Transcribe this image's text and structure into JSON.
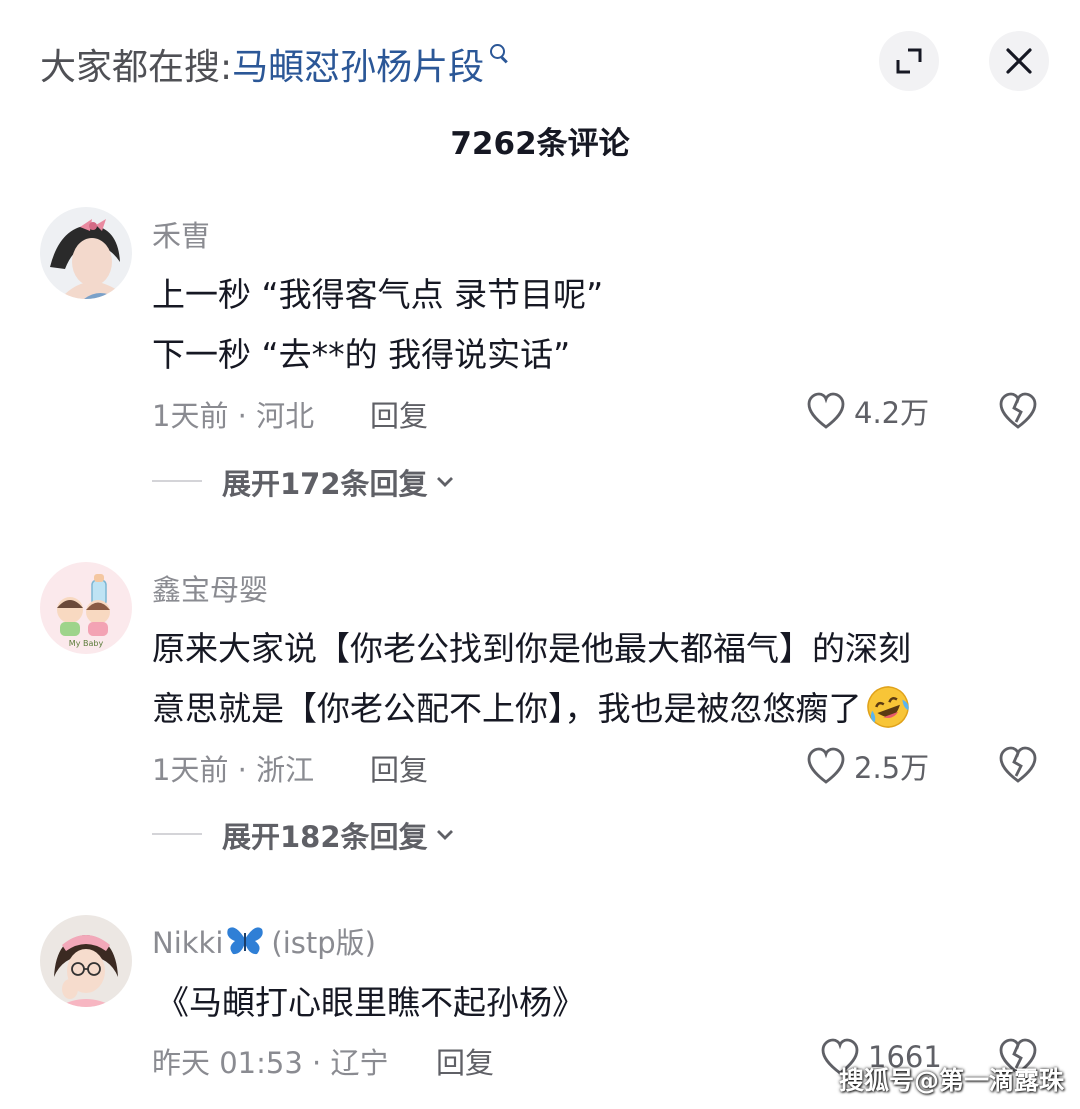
{
  "search": {
    "prefix": "大家都在搜:",
    "query": "马頔怼孙杨片段"
  },
  "comment_count": "7262条评论",
  "comments": [
    {
      "username": "禾曺",
      "lines": [
        "上一秒 “我得客气点  录节目呢”",
        "下一秒 “去**的  我得说实话”"
      ],
      "meta": "1天前 · 河北",
      "reply_label": "回复",
      "likes": "4.2万",
      "expand_label": "展开172条回复"
    },
    {
      "username": "鑫宝母婴",
      "lines": [
        "原来大家说【你老公找到你是他最大都福气】的深刻",
        "意思就是【你老公配不上你】，我也是被忽悠瘸了"
      ],
      "meta": "1天前 · 浙江",
      "reply_label": "回复",
      "likes": "2.5万",
      "expand_label": "展开182条回复",
      "avatar_text": "My Baby"
    },
    {
      "username": "Nikki",
      "username_suffix": "(istp版)",
      "lines": [
        "《马頔打心眼里瞧不起孙杨》"
      ],
      "meta": "昨天 01:53 · 辽宁",
      "reply_label": "回复",
      "likes": "1661"
    }
  ],
  "watermark": "搜狐号@第一滴露珠",
  "icons": [
    "search-icon",
    "expand-icon",
    "close-icon",
    "heart-icon",
    "broken-heart-icon",
    "chevron-down-icon",
    "butterfly-icon",
    "laughing-crying-emoji"
  ],
  "colors": {
    "link": "#2b5797",
    "secondary_text": "#8a8b91",
    "primary_text": "#161823",
    "button_bg": "#f2f2f4"
  }
}
